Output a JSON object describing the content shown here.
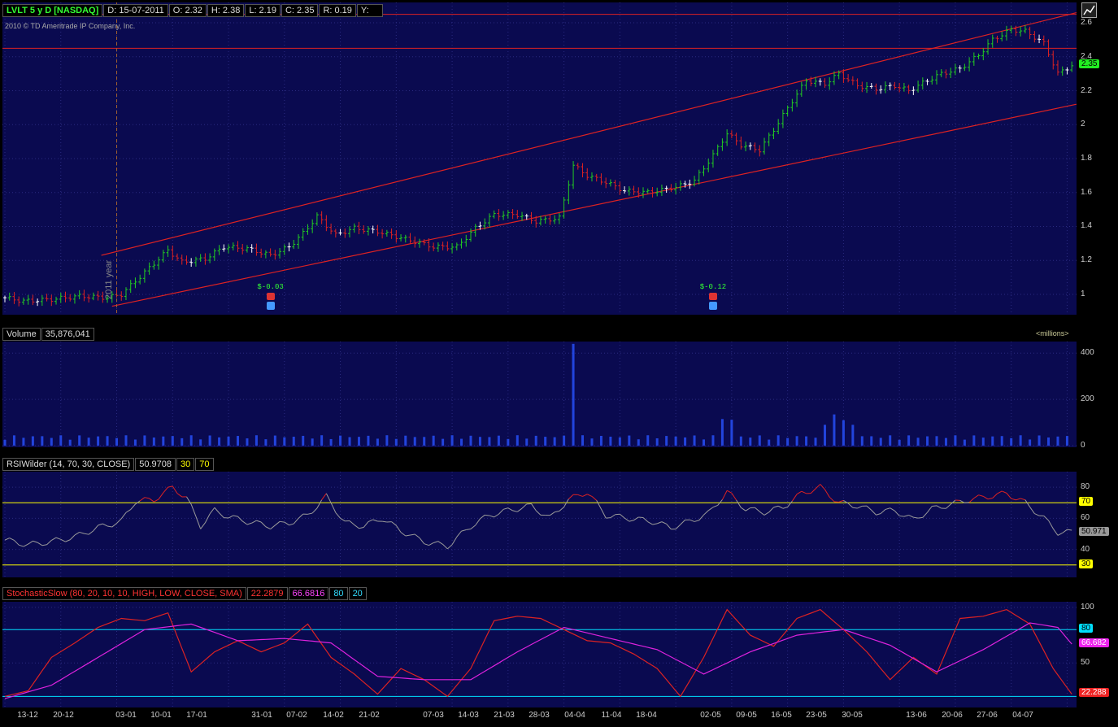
{
  "header": {
    "symbol": "LVLT 5 y D [NASDAQ]",
    "date": "D: 15-07-2011",
    "open": "O: 2.32",
    "high": "H: 2.38",
    "low": "L: 2.19",
    "close": "C: 2.35",
    "range": "R: 0.19",
    "y": "Y:"
  },
  "copyright": "2010 © TD Ameritrade IP Company, Inc.",
  "year_marker": "2011 year",
  "events": [
    {
      "label": "$-0.03",
      "date": "26-01"
    },
    {
      "label": "$-0.12",
      "date": "27-04"
    }
  ],
  "volume_panel": {
    "title": "Volume",
    "value": "35,876,041",
    "unit": "<millions>"
  },
  "rsi_panel": {
    "title": "RSIWilder (14, 70, 30, CLOSE)",
    "value": "50.9708",
    "lower": "30",
    "upper": "70",
    "tag": "50.971"
  },
  "stoch_panel": {
    "title": "StochasticSlow (80, 20, 10, 10, HIGH, LOW, CLOSE, SMA)",
    "k_value": "22.2879",
    "d_value": "66.6816",
    "upper": "80",
    "lower": "20",
    "k_tag": "22.288",
    "d_tag": "66.682"
  },
  "price_tag": "2.35",
  "colors": {
    "background": "#0a0a50",
    "up": "#22cc22",
    "down": "#dd2222",
    "neutral": "#ffffff",
    "channel": "#dd2222",
    "volume": "#2244dd",
    "rsi_line": "#9a9a9a",
    "rsi_over": "#dd2222",
    "threshold_rsi": "#ffff00",
    "threshold_stoch": "#00e0ff",
    "stoch_k": "#dd2222",
    "stoch_d": "#dd22dd"
  },
  "chart_data": [
    {
      "type": "candlestick",
      "title": "LVLT 5 y D [NASDAQ]",
      "ylim": [
        0.88,
        2.72
      ],
      "yticks": [
        1,
        1.2,
        1.4,
        1.6,
        1.8,
        2,
        2.2,
        2.4,
        2.6
      ],
      "x_ticks": [
        "13-12",
        "20-12",
        "03-01",
        "10-01",
        "17-01",
        "31-01",
        "07-02",
        "14-02",
        "21-02",
        "07-03",
        "14-03",
        "21-03",
        "28-03",
        "04-04",
        "11-04",
        "18-04",
        "02-05",
        "09-05",
        "16-05",
        "23-05",
        "30-05",
        "13-06",
        "20-06",
        "27-06",
        "04-07"
      ],
      "horizontal_lines": [
        2.65,
        2.45
      ],
      "channel": {
        "upper": [
          [
            0.09,
            1.23
          ],
          [
            1.0,
            2.66
          ]
        ],
        "lower": [
          [
            0.1,
            0.93
          ],
          [
            1.0,
            2.12
          ]
        ]
      },
      "close_anchors": [
        [
          0,
          0.98
        ],
        [
          4,
          0.96
        ],
        [
          10,
          0.97
        ],
        [
          16,
          0.99
        ],
        [
          22,
          0.98
        ],
        [
          25,
          1.0
        ],
        [
          30,
          1.13
        ],
        [
          35,
          1.26
        ],
        [
          38,
          1.19
        ],
        [
          43,
          1.21
        ],
        [
          47,
          1.28
        ],
        [
          52,
          1.27
        ],
        [
          57,
          1.23
        ],
        [
          61,
          1.28
        ],
        [
          64,
          1.36
        ],
        [
          67,
          1.46
        ],
        [
          71,
          1.35
        ],
        [
          75,
          1.39
        ],
        [
          80,
          1.37
        ],
        [
          84,
          1.34
        ],
        [
          88,
          1.31
        ],
        [
          92,
          1.28
        ],
        [
          97,
          1.28
        ],
        [
          101,
          1.39
        ],
        [
          105,
          1.47
        ],
        [
          110,
          1.47
        ],
        [
          114,
          1.43
        ],
        [
          119,
          1.45
        ],
        [
          122,
          1.76
        ],
        [
          125,
          1.7
        ],
        [
          129,
          1.66
        ],
        [
          133,
          1.61
        ],
        [
          138,
          1.6
        ],
        [
          142,
          1.62
        ],
        [
          145,
          1.64
        ],
        [
          148,
          1.67
        ],
        [
          152,
          1.82
        ],
        [
          155,
          1.95
        ],
        [
          158,
          1.88
        ],
        [
          162,
          1.85
        ],
        [
          165,
          1.97
        ],
        [
          169,
          2.14
        ],
        [
          172,
          2.26
        ],
        [
          176,
          2.24
        ],
        [
          179,
          2.3
        ],
        [
          183,
          2.23
        ],
        [
          187,
          2.21
        ],
        [
          191,
          2.23
        ],
        [
          194,
          2.2
        ],
        [
          198,
          2.26
        ],
        [
          201,
          2.3
        ],
        [
          205,
          2.33
        ],
        [
          209,
          2.41
        ],
        [
          212,
          2.5
        ],
        [
          216,
          2.56
        ],
        [
          219,
          2.55
        ],
        [
          223,
          2.48
        ],
        [
          226,
          2.3
        ],
        [
          229,
          2.35
        ]
      ],
      "last_close": 2.35
    },
    {
      "type": "bar",
      "title": "Volume",
      "unit": "millions",
      "ylim": [
        0,
        450
      ],
      "yticks": [
        0,
        200,
        400
      ],
      "spikes": [
        [
          122,
          440
        ],
        [
          154,
          115
        ],
        [
          155,
          120
        ],
        [
          156,
          112
        ],
        [
          157,
          105
        ],
        [
          177,
          90
        ],
        [
          179,
          135
        ],
        [
          180,
          110
        ],
        [
          181,
          105
        ],
        [
          182,
          90
        ]
      ],
      "baseline": 25
    },
    {
      "type": "line",
      "title": "RSIWilder (14, 70, 30, CLOSE)",
      "ylim": [
        22,
        90
      ],
      "yticks": [
        40,
        60,
        80
      ],
      "thresholds": [
        70,
        30
      ],
      "series": [
        {
          "name": "RSI",
          "anchors": [
            [
              0,
              46
            ],
            [
              5,
              43
            ],
            [
              10,
              45
            ],
            [
              15,
              48
            ],
            [
              20,
              54
            ],
            [
              25,
              58
            ],
            [
              28,
              71
            ],
            [
              32,
              72
            ],
            [
              36,
              80
            ],
            [
              39,
              73
            ],
            [
              42,
              55
            ],
            [
              45,
              65
            ],
            [
              48,
              61
            ],
            [
              52,
              58
            ],
            [
              57,
              55
            ],
            [
              61,
              57
            ],
            [
              65,
              62
            ],
            [
              69,
              74
            ],
            [
              73,
              57
            ],
            [
              77,
              55
            ],
            [
              81,
              60
            ],
            [
              85,
              52
            ],
            [
              90,
              45
            ],
            [
              95,
              42
            ],
            [
              100,
              55
            ],
            [
              104,
              62
            ],
            [
              108,
              65
            ],
            [
              113,
              68
            ],
            [
              117,
              60
            ],
            [
              121,
              72
            ],
            [
              125,
              77
            ],
            [
              129,
              62
            ],
            [
              134,
              60
            ],
            [
              139,
              58
            ],
            [
              143,
              54
            ],
            [
              147,
              58
            ],
            [
              151,
              63
            ],
            [
              155,
              77
            ],
            [
              159,
              66
            ],
            [
              163,
              64
            ],
            [
              167,
              67
            ],
            [
              171,
              76
            ],
            [
              175,
              80
            ],
            [
              179,
              70
            ],
            [
              183,
              68
            ],
            [
              187,
              64
            ],
            [
              191,
              65
            ],
            [
              195,
              59
            ],
            [
              199,
              66
            ],
            [
              203,
              69
            ],
            [
              207,
              72
            ],
            [
              211,
              74
            ],
            [
              215,
              76
            ],
            [
              219,
              70
            ],
            [
              223,
              60
            ],
            [
              226,
              51
            ],
            [
              229,
              51
            ]
          ]
        }
      ]
    },
    {
      "type": "line",
      "title": "StochasticSlow (80, 20, 10, 10, HIGH, LOW, CLOSE, SMA)",
      "ylim": [
        10,
        105
      ],
      "yticks": [
        50,
        100
      ],
      "thresholds": [
        80,
        20
      ],
      "series": [
        {
          "name": "SlowK",
          "anchors": [
            [
              0,
              20
            ],
            [
              5,
              25
            ],
            [
              10,
              55
            ],
            [
              15,
              68
            ],
            [
              20,
              82
            ],
            [
              25,
              90
            ],
            [
              30,
              88
            ],
            [
              35,
              95
            ],
            [
              40,
              42
            ],
            [
              45,
              60
            ],
            [
              50,
              70
            ],
            [
              55,
              60
            ],
            [
              60,
              68
            ],
            [
              65,
              85
            ],
            [
              70,
              55
            ],
            [
              75,
              40
            ],
            [
              80,
              22
            ],
            [
              85,
              45
            ],
            [
              90,
              35
            ],
            [
              95,
              20
            ],
            [
              100,
              45
            ],
            [
              105,
              88
            ],
            [
              110,
              92
            ],
            [
              115,
              90
            ],
            [
              120,
              80
            ],
            [
              125,
              70
            ],
            [
              130,
              68
            ],
            [
              135,
              58
            ],
            [
              140,
              45
            ],
            [
              145,
              20
            ],
            [
              150,
              55
            ],
            [
              155,
              98
            ],
            [
              160,
              75
            ],
            [
              165,
              65
            ],
            [
              170,
              90
            ],
            [
              175,
              98
            ],
            [
              180,
              80
            ],
            [
              185,
              60
            ],
            [
              190,
              35
            ],
            [
              195,
              55
            ],
            [
              200,
              40
            ],
            [
              205,
              90
            ],
            [
              210,
              92
            ],
            [
              215,
              98
            ],
            [
              220,
              85
            ],
            [
              225,
              45
            ],
            [
              229,
              22
            ]
          ]
        },
        {
          "name": "SlowD",
          "anchors": [
            [
              0,
              18
            ],
            [
              10,
              30
            ],
            [
              20,
              55
            ],
            [
              30,
              80
            ],
            [
              40,
              85
            ],
            [
              50,
              70
            ],
            [
              60,
              72
            ],
            [
              70,
              68
            ],
            [
              80,
              38
            ],
            [
              90,
              35
            ],
            [
              100,
              35
            ],
            [
              110,
              60
            ],
            [
              120,
              82
            ],
            [
              130,
              72
            ],
            [
              140,
              62
            ],
            [
              150,
              40
            ],
            [
              160,
              60
            ],
            [
              170,
              75
            ],
            [
              180,
              80
            ],
            [
              190,
              66
            ],
            [
              200,
              42
            ],
            [
              210,
              62
            ],
            [
              220,
              86
            ],
            [
              226,
              82
            ],
            [
              229,
              67
            ]
          ]
        }
      ]
    }
  ]
}
